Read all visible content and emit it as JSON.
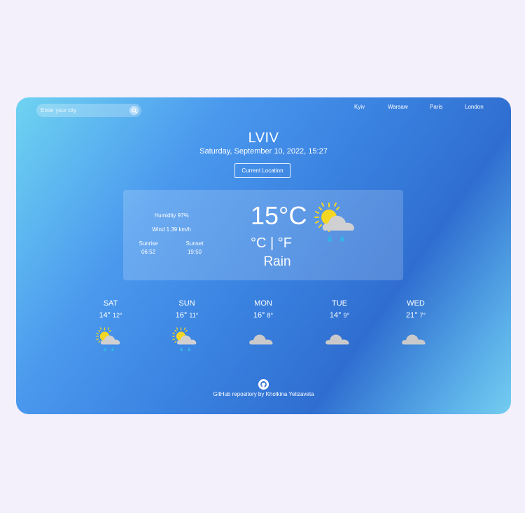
{
  "search": {
    "placeholder": "Enter your city"
  },
  "cities": [
    "Kyiv",
    "Warsaw",
    "Paris",
    "London"
  ],
  "current": {
    "city": "LVIV",
    "date": "Saturday, September 10, 2022, 15:27",
    "location_button": "Current Location",
    "humidity": "Humidity 97%",
    "wind": "Wind 1.39 km/h",
    "sunrise_label": "Sunrise",
    "sunrise_time": "06:52",
    "sunset_label": "Sunset",
    "sunset_time": "19:50",
    "temperature": "15°C",
    "units_c": "°C",
    "units_sep": "|",
    "units_f": "°F",
    "description": "Rain",
    "icon": "sun-cloud-rain-icon"
  },
  "forecast": [
    {
      "day": "SAT",
      "max": "14°",
      "min": "12°",
      "icon": "sun-cloud-rain-icon"
    },
    {
      "day": "SUN",
      "max": "16°",
      "min": "11°",
      "icon": "sun-cloud-rain-icon"
    },
    {
      "day": "MON",
      "max": "16°",
      "min": "8°",
      "icon": "cloud-icon"
    },
    {
      "day": "TUE",
      "max": "14°",
      "min": "9°",
      "icon": "cloud-icon"
    },
    {
      "day": "WED",
      "max": "21°",
      "min": "7°",
      "icon": "cloud-icon"
    }
  ],
  "footer": {
    "text": "GitHub repository by Kholkina Yelizaveta"
  },
  "colors": {
    "background": "#f3f0fb",
    "sun": "#f5d623",
    "cloud": "#c9c9cb",
    "rain": "#36b3e6"
  }
}
